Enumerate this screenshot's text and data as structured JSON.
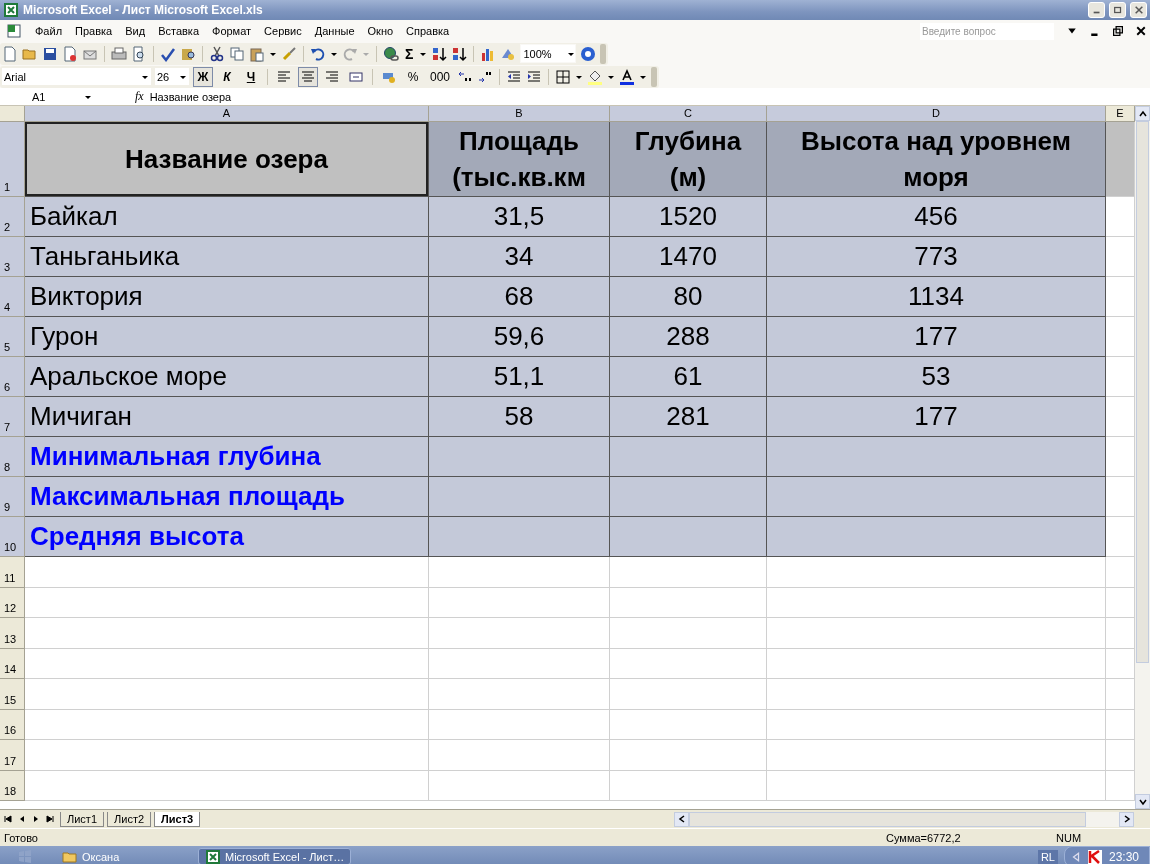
{
  "window": {
    "title": "Microsoft Excel - Лист Microsoft Excel.xls"
  },
  "menu": [
    "Файл",
    "Правка",
    "Вид",
    "Вставка",
    "Формат",
    "Сервис",
    "Данные",
    "Окно",
    "Справка"
  ],
  "help_box": {
    "placeholder": "Введите вопрос"
  },
  "standard_toolbar": {
    "sum": "Σ",
    "zoom": "100%"
  },
  "format_toolbar": {
    "font": "Arial",
    "size": "26",
    "buttons": [
      {
        "kind": "bold",
        "label": "Ж",
        "selected": true
      },
      {
        "kind": "italic",
        "label": "К",
        "selected": false
      },
      {
        "kind": "underline",
        "label": "Ч",
        "selected": false
      },
      {
        "kind": "align-left",
        "selected": false
      },
      {
        "kind": "align-center",
        "selected": true
      },
      {
        "kind": "align-right",
        "selected": false
      },
      {
        "kind": "merge",
        "selected": false
      },
      {
        "kind": "currency",
        "selected": false
      },
      {
        "kind": "text",
        "label": "%",
        "selected": false
      },
      {
        "kind": "text",
        "label": "000",
        "selected": false
      }
    ]
  },
  "formula_bar": {
    "name_box": "A1",
    "fx": "fx",
    "value": "Название озера"
  },
  "columns": [
    {
      "label": "A",
      "selected": true,
      "active": true
    },
    {
      "label": "B",
      "selected": true,
      "active": false
    },
    {
      "label": "C",
      "selected": true,
      "active": false
    },
    {
      "label": "D",
      "selected": true,
      "active": false
    },
    {
      "label": "E",
      "selected": false,
      "active": false
    }
  ],
  "rows": [
    {
      "number": "1",
      "kind": "header",
      "selected": true,
      "active": true,
      "cells": [
        "Название озера",
        "Площадь (тыс.кв.км",
        "Глубина (м)",
        "Высота над уровнем моря"
      ]
    },
    {
      "number": "2",
      "kind": "data",
      "selected": true,
      "active": false,
      "cells": [
        "Байкал",
        "31,5",
        "1520",
        "456"
      ]
    },
    {
      "number": "3",
      "kind": "data",
      "selected": true,
      "active": false,
      "cells": [
        "Таньганьика",
        "34",
        "1470",
        "773"
      ]
    },
    {
      "number": "4",
      "kind": "data",
      "selected": true,
      "active": false,
      "cells": [
        "Виктория",
        "68",
        "80",
        "1134"
      ]
    },
    {
      "number": "5",
      "kind": "data",
      "selected": true,
      "active": false,
      "cells": [
        "Гурон",
        "59,6",
        "288",
        "177"
      ]
    },
    {
      "number": "6",
      "kind": "data",
      "selected": true,
      "active": false,
      "cells": [
        "Аральское море",
        "51,1",
        "61",
        "53"
      ]
    },
    {
      "number": "7",
      "kind": "data",
      "selected": true,
      "active": false,
      "cells": [
        "Мичиган",
        "58",
        "281",
        "177"
      ]
    },
    {
      "number": "8",
      "kind": "summary",
      "selected": true,
      "active": false,
      "cells": [
        "Минимальная глубина"
      ]
    },
    {
      "number": "9",
      "kind": "summary",
      "selected": true,
      "active": false,
      "cells": [
        "Максимальная площадь"
      ]
    },
    {
      "number": "10",
      "kind": "summary",
      "selected": true,
      "active": false,
      "cells": [
        "Средняя высота"
      ]
    },
    {
      "number": "11",
      "kind": "empty",
      "selected": false,
      "active": false
    },
    {
      "number": "12",
      "kind": "empty",
      "selected": false,
      "active": false
    },
    {
      "number": "13",
      "kind": "empty",
      "selected": false,
      "active": false
    },
    {
      "number": "14",
      "kind": "empty",
      "selected": false,
      "active": false
    },
    {
      "number": "15",
      "kind": "empty",
      "selected": false,
      "active": false
    },
    {
      "number": "16",
      "kind": "empty",
      "selected": false,
      "active": false
    },
    {
      "number": "17",
      "kind": "empty",
      "selected": false,
      "active": false
    },
    {
      "number": "18",
      "kind": "empty",
      "selected": false,
      "active": false
    }
  ],
  "sheet_tabs": [
    {
      "label": "Лист1",
      "selected": false
    },
    {
      "label": "Лист2",
      "selected": false
    },
    {
      "label": "Лист3",
      "selected": true
    }
  ],
  "status_bar": {
    "status": "Готово",
    "sum": "Сумма=6772,2",
    "num": "NUM"
  },
  "taskbar": {
    "tasks": [
      {
        "label": "Оксана",
        "selected": false,
        "kind": "folder"
      },
      {
        "label": "Microsoft Excel - Лист…",
        "selected": true,
        "kind": "excel"
      }
    ],
    "language": "RL",
    "clock": "23:30"
  }
}
